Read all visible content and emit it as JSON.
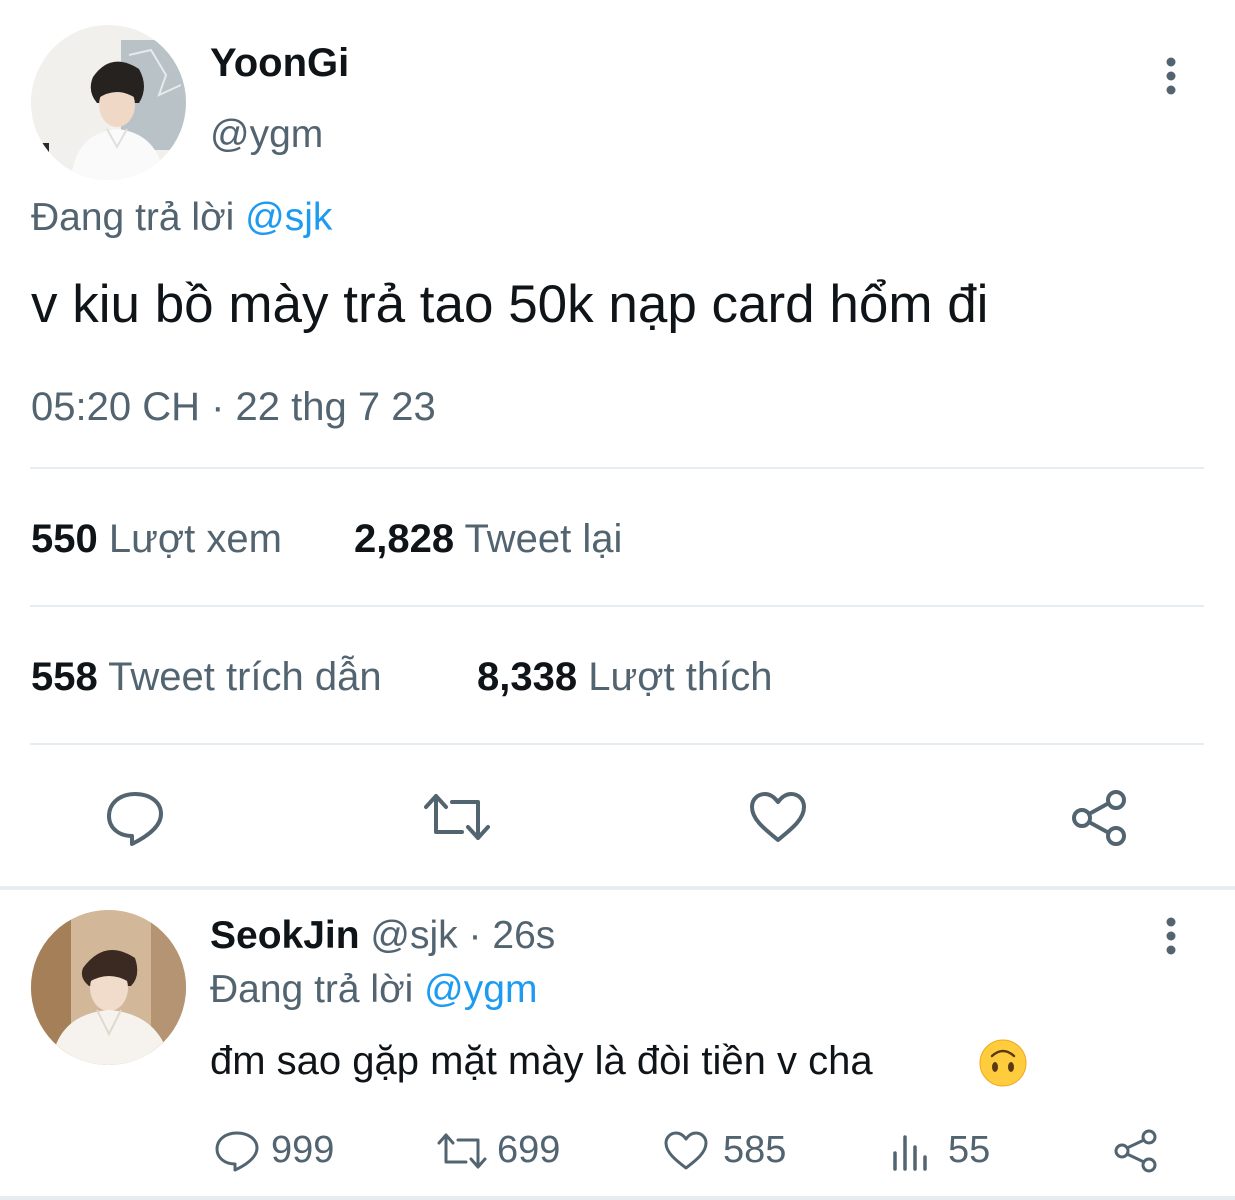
{
  "main_tweet": {
    "author_name": "YoonGi",
    "author_handle": "@ygm",
    "replying_prefix": "Đang trả lời",
    "replying_to": "@sjk",
    "text": "v kiu bồ mày trả tao 50k nạp card hổm đi",
    "timestamp": "05:20 CH · 22 thg 7 23",
    "stats": [
      {
        "value": "550",
        "label": "Lượt xem"
      },
      {
        "value": "2,828",
        "label": "Tweet lại"
      },
      {
        "value": "558",
        "label": "Tweet trích dẫn"
      },
      {
        "value": "8,338",
        "label": "Lượt thích"
      }
    ],
    "actions": [
      "reply-icon",
      "retweet-icon",
      "like-icon",
      "share-icon"
    ]
  },
  "reply_tweet": {
    "author_name": "SeokJin",
    "author_handle": "@sjk",
    "separator": "·",
    "time": "26s",
    "replying_prefix": "Đang trả lời",
    "replying_to": "@ygm",
    "text": "đm sao gặp mặt mày là đòi tiền v cha",
    "emoji": "🙃",
    "actions": {
      "replies": "999",
      "retweets": "699",
      "likes": "585",
      "views": "55"
    }
  },
  "colors": {
    "text": "#0f1419",
    "secondary": "#536471",
    "accent": "#1d9bf0",
    "divider": "#e6ecf0"
  }
}
